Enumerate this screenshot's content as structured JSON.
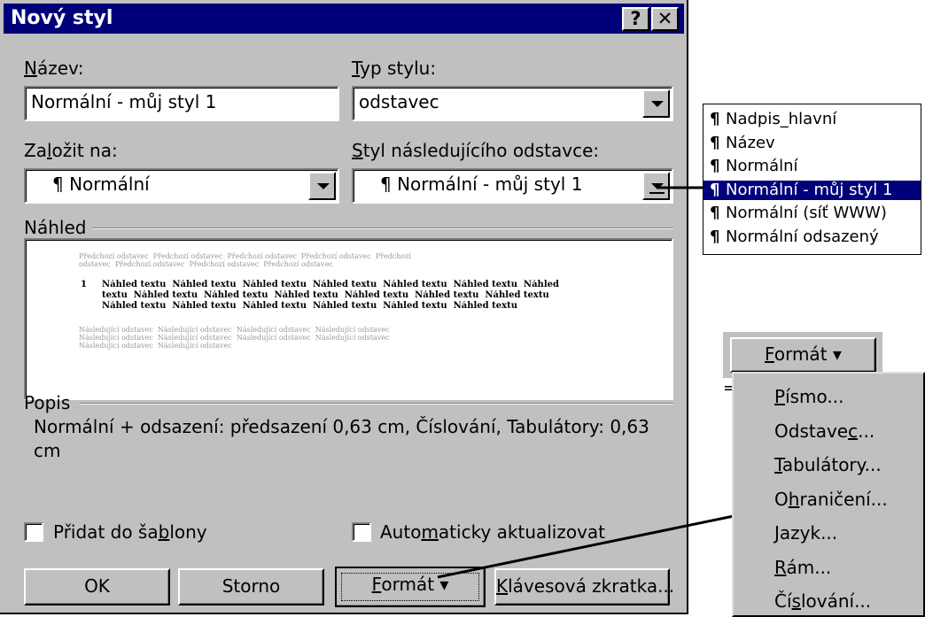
{
  "dialog": {
    "title": "Nový styl",
    "help_glyph": "?",
    "close_glyph": "✕"
  },
  "name": {
    "label_u": "N",
    "label_rest": "ázev:",
    "value": "Normální - můj styl 1"
  },
  "type": {
    "label_u": "T",
    "label_rest": "yp stylu:",
    "value": "odstavec"
  },
  "based_on": {
    "label_pre": "Za",
    "label_u": "l",
    "label_rest": "ožit na:",
    "value": "¶ Normální"
  },
  "next_style": {
    "label_u": "S",
    "label_rest": "tyl následujícího odstavce:",
    "value": "¶ Normální - můj styl 1"
  },
  "preview": {
    "label": "Náhled",
    "prev_text_1": "Předchozí odstavec  Předchozí odstavec  Předchozí odstavec  Předchozí odstavec  Předchozí",
    "prev_text_2": "odstavec  Předchozí odstavec  Předchozí odstavec  Předchozí odstavec",
    "number": "1",
    "main_text_1": "Náhled textu  Náhled textu  Náhled textu  Náhled textu  Náhled textu  Náhled textu  Náhled",
    "main_text_2": "textu  Náhled textu  Náhled textu  Náhled textu  Náhled textu  Náhled textu  Náhled textu",
    "main_text_3": "Náhled textu  Náhled textu  Náhled textu  Náhled textu  Náhled textu  Náhled textu",
    "next_text_1": "Následující odstavec  Následující odstavec  Následující odstavec  Následující odstavec",
    "next_text_2": "Následující odstavec  Následující odstavec  Následující odstavec  Následující odstavec",
    "next_text_3": "Následující odstavec  Následující odstavec"
  },
  "description": {
    "label": "Popis",
    "text_1": "Normální + odsazení:   předsazení 0,63 cm, Číslování, Tabulátory: 0,63",
    "text_2": "cm"
  },
  "options": {
    "add_template_pre": "Přidat do ša",
    "add_template_u": "b",
    "add_template_rest": "lony",
    "auto_update_pre": "Auto",
    "auto_update_u": "m",
    "auto_update_rest": "aticky aktualizovat"
  },
  "buttons": {
    "ok": "OK",
    "cancel": "Storno",
    "format_u": "F",
    "format_rest": "ormát",
    "format_arrow": "▾",
    "shortcut_u": "K",
    "shortcut_rest": "lávesová zkratka..."
  },
  "style_list": {
    "items": [
      "Nadpis_hlavní",
      "Název",
      "Normální",
      "Normální - můj styl 1",
      "Normální (síť WWW)",
      "Normální odsazený"
    ],
    "pilcrow": "¶",
    "selected_index": 3
  },
  "format_menu": {
    "button_u": "F",
    "button_rest": "ormát",
    "arrow": "▾",
    "stray_mark": "=",
    "items": [
      {
        "u": "P",
        "rest": "ísmo...",
        "pre": ""
      },
      {
        "pre": "Odstave",
        "u": "c",
        "rest": "..."
      },
      {
        "pre": "",
        "u": "T",
        "rest": "abulátory..."
      },
      {
        "pre": "O",
        "u": "h",
        "rest": "raničení..."
      },
      {
        "pre": "",
        "u": "J",
        "rest": "azyk..."
      },
      {
        "pre": "",
        "u": "R",
        "rest": "ám..."
      },
      {
        "pre": "Čí",
        "u": "s",
        "rest": "lování..."
      }
    ]
  },
  "colors": {
    "title_bar": "#00007b",
    "face": "#c0c0c0",
    "selection": "#00007b"
  }
}
